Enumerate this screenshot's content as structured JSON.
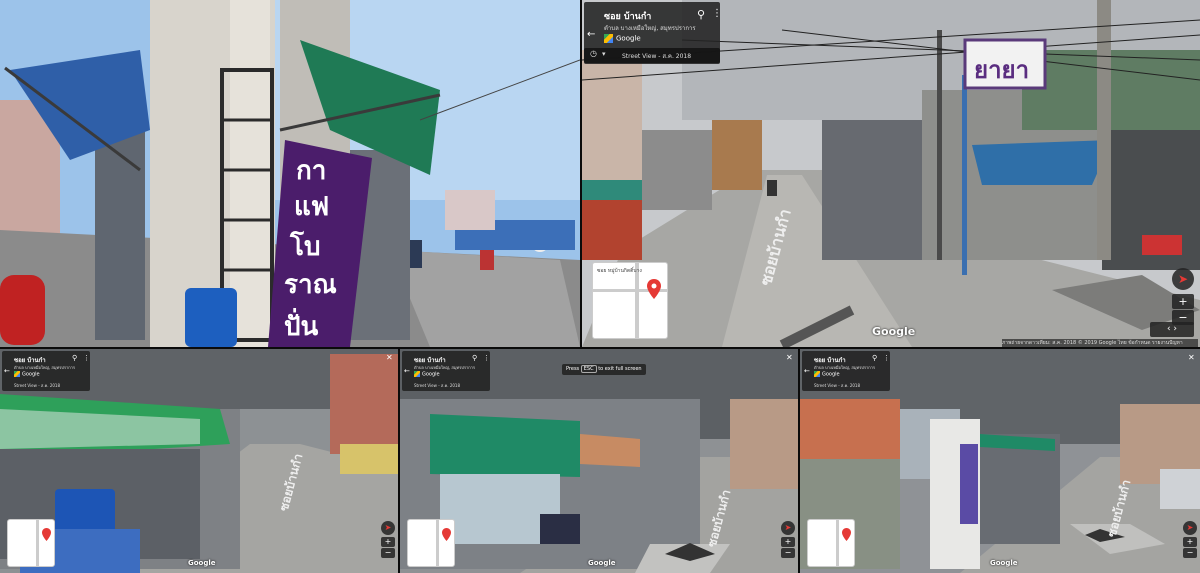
{
  "sign": {
    "lines": [
      "กา",
      "แฟ",
      "โบ",
      "ราณ",
      "ปั่น"
    ]
  },
  "shop_sign_text": "ยายา",
  "streetview_main": {
    "title": "ซอย บ้านกำ",
    "subtitle": "ตำบล บางเหมือใหญ่, สมุทรปราการ",
    "google_label": "Google",
    "date_label": "Street View - ส.ค. 2018",
    "footer": "ภาพถ่ายจากดาวเทียม: ส.ค. 2018   © 2019 Google   ไทย   ข้อกำหนด   รายงานปัญหา",
    "map_label": "ซอย หมู่บ้านกิตติ์บาง",
    "watermark": "Google"
  },
  "streetview_small_1": {
    "title": "ซอย บ้านกำ",
    "subtitle": "ตำบล บางเหมือใหญ่, สมุทรปราการ",
    "google_label": "Google",
    "date_label": "Street View - ส.ค. 2018",
    "watermark": "Google"
  },
  "streetview_small_2": {
    "title": "ซอย บ้านกำ",
    "subtitle": "ตำบล บางเหมือใหญ่, สมุทรปราการ",
    "google_label": "Google",
    "date_label": "Street View - ส.ค. 2018",
    "hint_press": "Press",
    "hint_key": "ESC",
    "hint_rest": "to exit full screen",
    "watermark": "Google"
  },
  "streetview_small_3": {
    "title": "ซอย บ้านกำ",
    "subtitle": "ตำบล บางเหมือใหญ่, สมุทรปราการ",
    "google_label": "Google",
    "date_label": "Street View - ส.ค. 2018",
    "watermark": "Google"
  },
  "road_marking": "ซอยบ้านกำ",
  "colors": {
    "awning_blue": "#2f5fa8",
    "awning_green": "#1f7a55",
    "sign_purple": "#4b1d6b",
    "pin_red": "#e53935"
  },
  "icons": {
    "pin": "map-pin-icon",
    "more": "more-vert-icon",
    "back": "arrow-back-icon",
    "close": "close-icon",
    "zoom_in": "plus-icon",
    "zoom_out": "minus-icon",
    "compass": "compass-icon"
  }
}
